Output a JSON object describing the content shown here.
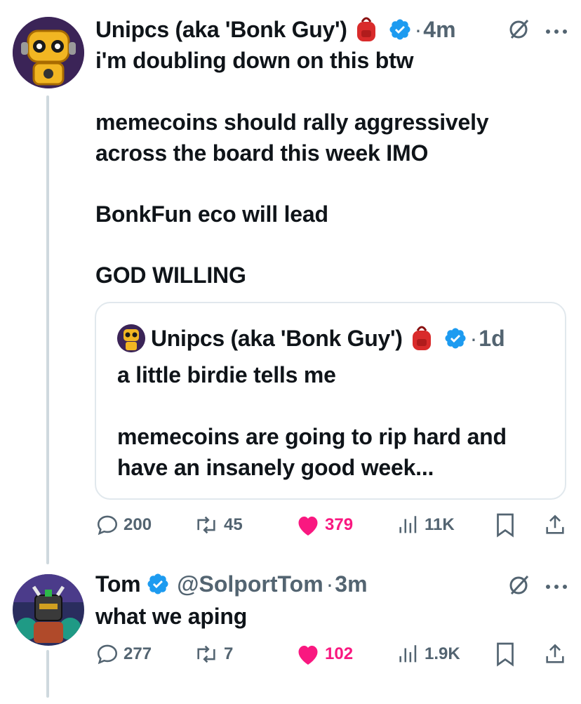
{
  "tweet": {
    "author_name": "Unipcs (aka 'Bonk Guy')",
    "author_emoji": "🎒",
    "time": "4m",
    "separator": "·",
    "lines": [
      "i'm doubling down on this btw",
      "memecoins should rally aggressively",
      "across the board this week IMO",
      "BonkFun eco will lead",
      "GOD WILLING"
    ],
    "quote": {
      "author_name": "Unipcs (aka 'Bonk Guy')",
      "time": "1d",
      "lines": [
        "a little birdie tells me",
        "memecoins are going to rip hard and",
        "have an insanely good week..."
      ]
    },
    "stats": {
      "replies": "200",
      "reposts": "45",
      "likes": "379",
      "views": "11K"
    }
  },
  "reply": {
    "author_name": "Tom",
    "handle": "@SolportTom",
    "time": "3m",
    "separator": "·",
    "text": "what we aping",
    "stats": {
      "replies": "277",
      "reposts": "7",
      "likes": "102",
      "views": "1.9K"
    }
  },
  "colors": {
    "verified": "#1d9bf0",
    "like": "#f91880",
    "muted": "#536471",
    "backpack": "#d92b2b"
  },
  "icons": [
    "reply-icon",
    "repost-icon",
    "heart-icon",
    "views-icon",
    "bookmark-icon",
    "share-icon",
    "grok-icon",
    "more-icon",
    "verified-icon",
    "backpack-icon"
  ]
}
